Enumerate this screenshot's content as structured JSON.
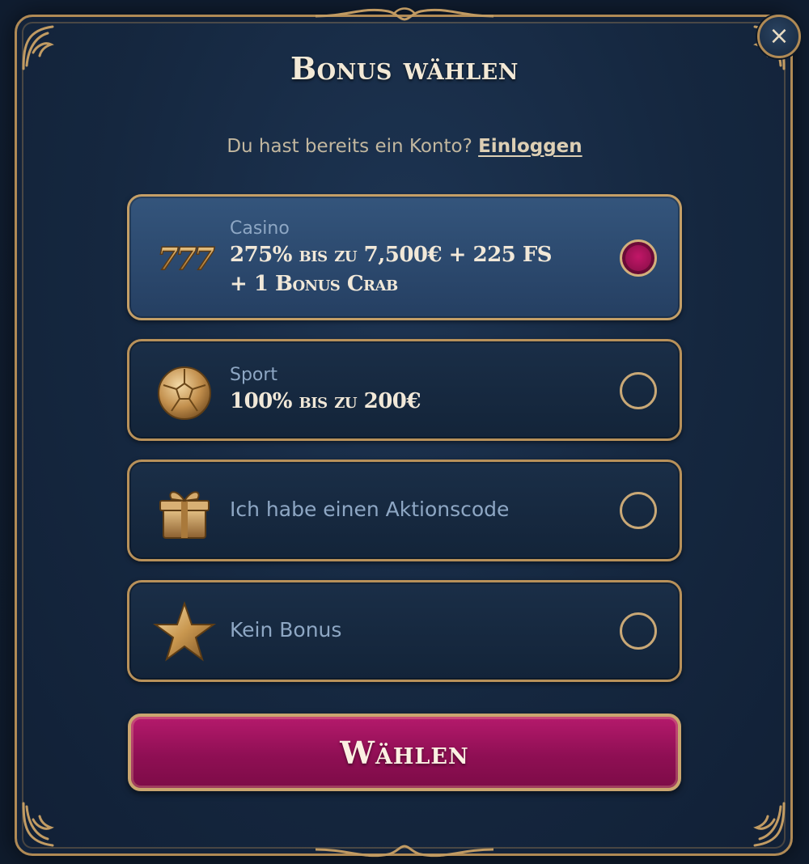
{
  "modal": {
    "title": "Bonus wählen",
    "close_icon": "close-icon",
    "login_prompt": "Du hast bereits ein Konto?",
    "login_link": "Einloggen"
  },
  "options": [
    {
      "icon": "slot-777-icon",
      "category": "Casino",
      "offer_line1": "275% bis zu 7,500€ + 225 FS",
      "offer_line2": "+ 1 Bonus Crab",
      "selected": true
    },
    {
      "icon": "soccer-ball-icon",
      "category": "Sport",
      "offer_line1": "100% bis zu 200€",
      "selected": false
    },
    {
      "icon": "gift-box-icon",
      "label": "Ich habe einen Aktionscode",
      "selected": false
    },
    {
      "icon": "star-icon",
      "label": "Kein Bonus",
      "selected": false
    }
  ],
  "submit": {
    "label": "Wählen"
  },
  "colors": {
    "accent_gold": "#b8915a",
    "primary_magenta": "#a3155f",
    "selected_bg": "#2f4e74",
    "panel_bg": "#15273f"
  }
}
